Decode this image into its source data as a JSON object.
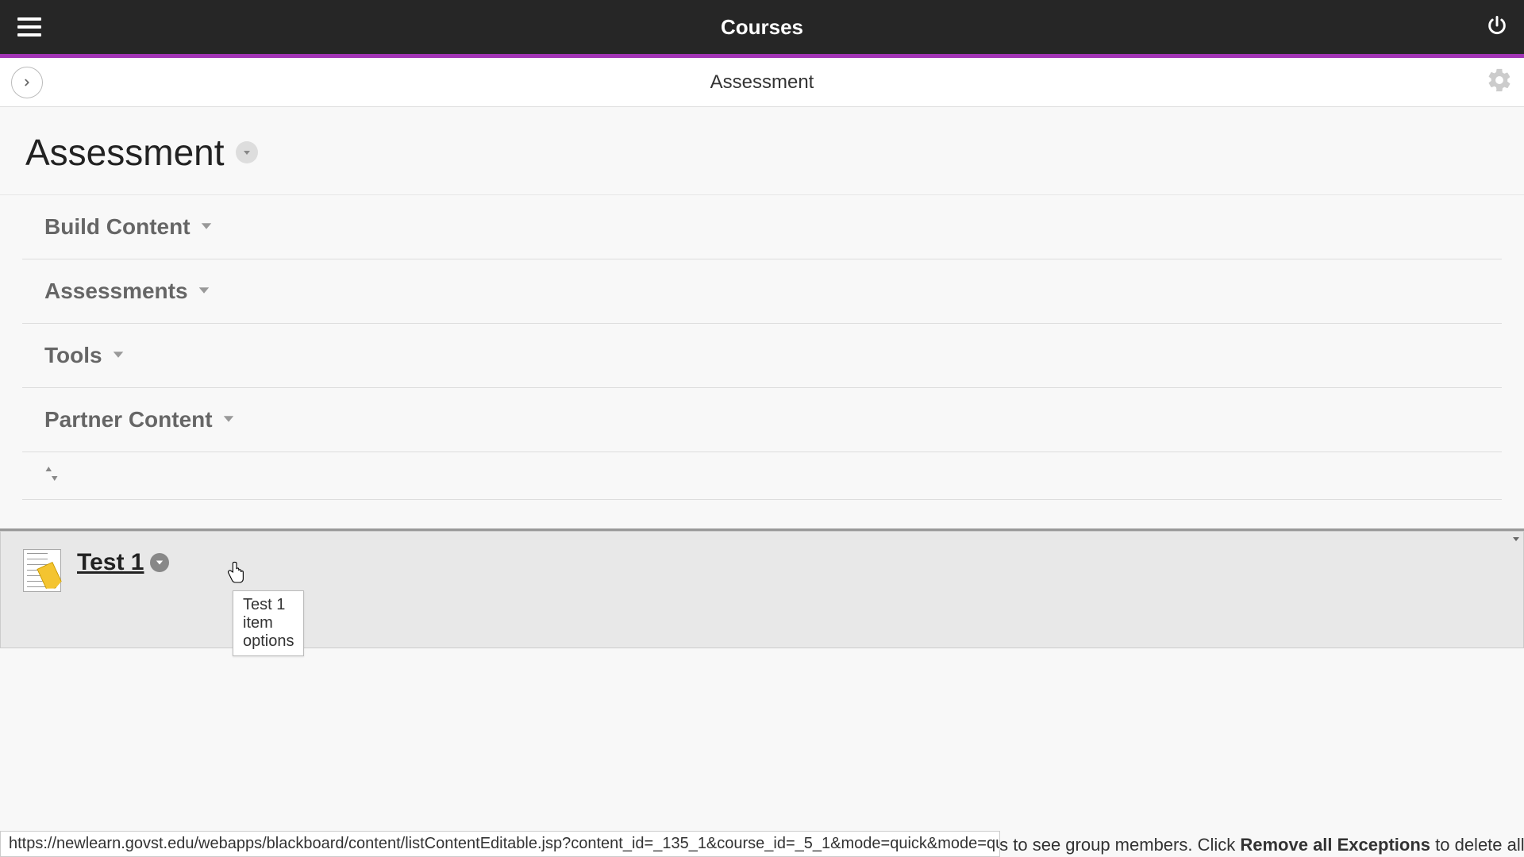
{
  "header": {
    "title": "Courses"
  },
  "subheader": {
    "title": "Assessment"
  },
  "page": {
    "title": "Assessment"
  },
  "menu": {
    "items": [
      {
        "label": "Build Content"
      },
      {
        "label": "Assessments"
      },
      {
        "label": "Tools"
      },
      {
        "label": "Partner Content"
      }
    ]
  },
  "content": {
    "item_title": "Test 1",
    "tooltip": "Test 1 item options"
  },
  "statusbar": {
    "url": "https://newlearn.govst.edu/webapps/blackboard/content/listContentEditable.jsp?content_id=_135_1&course_id=_5_1&mode=quick&mode=quick#contextMenu"
  },
  "bg_text": {
    "prefix": "want students to see group members. Click ",
    "bold": "Remove all Exceptions",
    "suffix": " to delete all ex"
  }
}
